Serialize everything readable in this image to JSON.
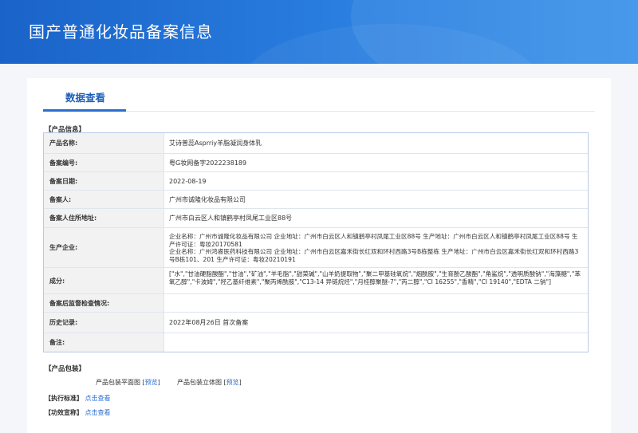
{
  "header": {
    "title": "国产普通化妆品备案信息"
  },
  "tabs": [
    {
      "label": "数据查看"
    }
  ],
  "sections": {
    "product_info": "【产品信息】",
    "packaging": "【产品包装】",
    "standard": "【执行标准】",
    "efficacy": "【功效宣称】"
  },
  "product": {
    "rows": [
      {
        "label": "产品名称:",
        "value": "艾诗普蕊Asprriy羊脂凝润身体乳"
      },
      {
        "label": "备案编号:",
        "value": "粤G妆网备字2022238189"
      },
      {
        "label": "备案日期:",
        "value": "2022-08-19"
      },
      {
        "label": "备案人:",
        "value": "广州市诚隆化妆品有限公司"
      },
      {
        "label": "备案人住所地址:",
        "value": "广州市白云区人和镇鹤亭村凤尾工业区88号"
      },
      {
        "label": "生产企业:",
        "value": "企业名称：广州市诚隆化妆品有限公司 企业地址：广州市白云区人和镇鹤亭村凤尾工业区88号 生产地址：广州市白云区人和镇鹤亭村凤尾工业区88号 生产许可证：粤妆20170581\n企业名称：广州鸿睿医药科技有限公司 企业地址：广州市白云区嘉禾街长红双和环村西路3号B栋整栋 生产地址：广州市白云区嘉禾街长红双和环村西路3号B栋101、201 生产许可证：粤妆20210191"
      },
      {
        "label": "成分:",
        "value": "[\"水\",\"甘油硬脂酸酯\",\"甘油\",\"矿油\",\"羊毛脂\",\"甜菜碱\",\"山羊奶提取物\",\"聚二甲基硅氧烷\",\"烟酰胺\",\"生育酚乙酸酯\",\"角鲨烷\",\"透明质酸钠\",\"海藻糖\",\"苯氧乙醇\",\"卡波姆\",\"羟乙基纤维素\",\"聚丙烯酰胺\",\"C13-14 异链烷烃\",\"月桂醇聚醚-7\",\"丙二醇\",\"CI 16255\",\"香精\",\"CI 19140\",\"EDTA 二钠\"]"
      },
      {
        "label": "备案后监督检查情况:",
        "value": ""
      },
      {
        "label": "历史记录:",
        "value": "2022年08月26日 首次备案"
      },
      {
        "label": "备注:",
        "value": ""
      }
    ]
  },
  "packaging": {
    "flat_label": "产品包装平面图",
    "flat_link": "预览",
    "solid_label": "产品包装立体图",
    "solid_link": "预览"
  },
  "standard": {
    "link": "点击查看"
  },
  "efficacy": {
    "link": "点击查看"
  }
}
